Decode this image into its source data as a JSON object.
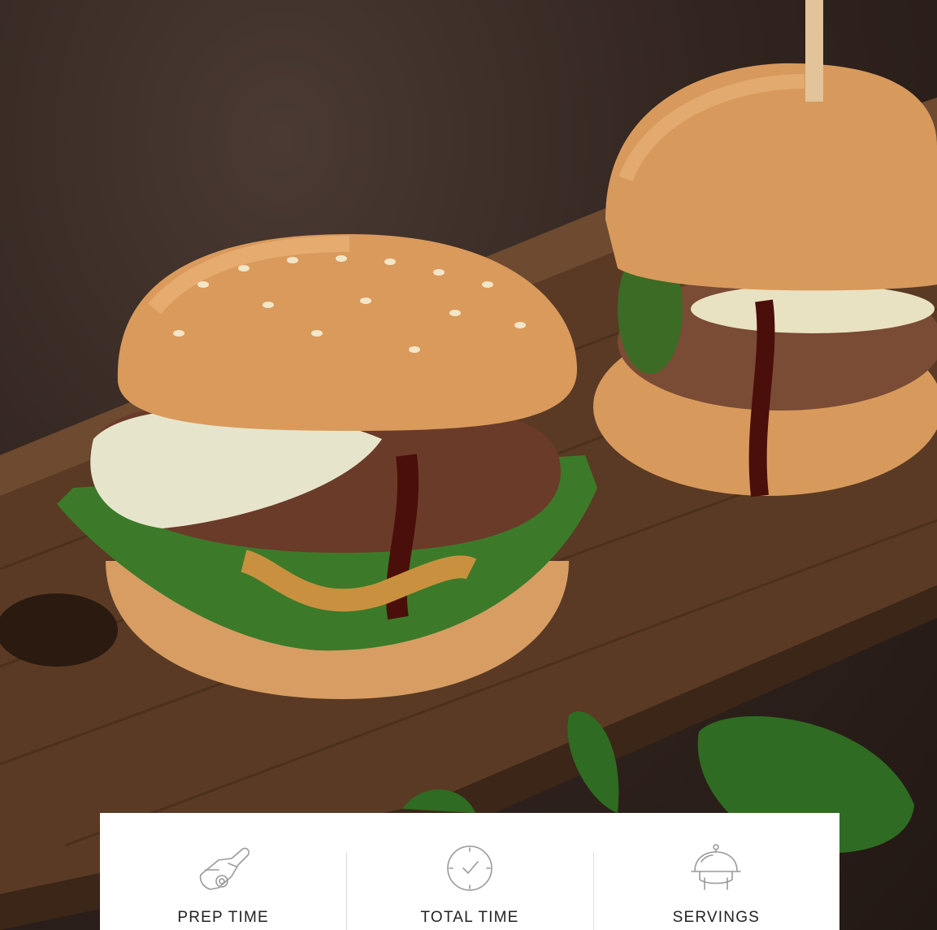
{
  "hero": {
    "image_subject": "burger-photo"
  },
  "recipe_stats": [
    {
      "label": "PREP TIME",
      "icon": "knife-cutting-board-icon"
    },
    {
      "label": "TOTAL TIME",
      "icon": "clock-icon"
    },
    {
      "label": "SERVINGS",
      "icon": "serving-cloche-icon"
    }
  ],
  "colors": {
    "card_background": "#ffffff",
    "label_text": "#222222",
    "icon_stroke": "#9a9a9a",
    "divider": "#dcdcdc"
  }
}
